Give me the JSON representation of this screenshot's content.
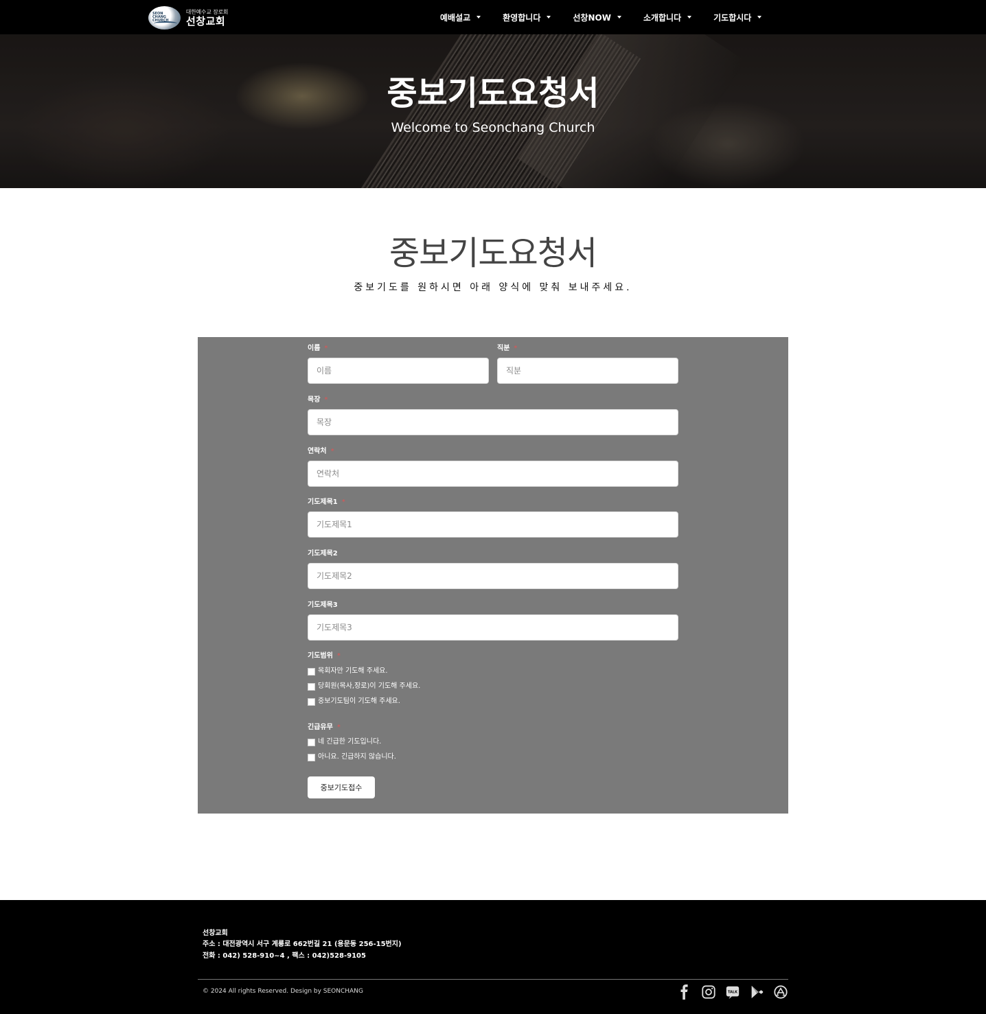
{
  "header": {
    "logo_sub": "대한예수교 장로회",
    "logo_main": "선창교회",
    "logo_badge": "SEON CHANG CHURCH",
    "nav": [
      {
        "label": "예배설교"
      },
      {
        "label": "환영합니다"
      },
      {
        "label": "선창NOW"
      },
      {
        "label": "소개합니다"
      },
      {
        "label": "기도합시다"
      }
    ]
  },
  "hero": {
    "title": "중보기도요청서",
    "subtitle": "Welcome to  Seonchang Church"
  },
  "section": {
    "title": "중보기도요청서",
    "subtitle": "중보기도를 원하시면 아래 양식에 맞춰 보내주세요."
  },
  "form": {
    "required_mark": "*",
    "fields": {
      "name": {
        "label": "이름",
        "placeholder": "이름"
      },
      "position": {
        "label": "직분",
        "placeholder": "직분"
      },
      "mokjang": {
        "label": "목장",
        "placeholder": "목장"
      },
      "contact": {
        "label": "연락처",
        "placeholder": "연락처"
      },
      "title1": {
        "label": "기도제목1",
        "placeholder": "기도제목1"
      },
      "title2": {
        "label": "기도제목2",
        "placeholder": "기도제목2"
      },
      "title3": {
        "label": "기도제목3",
        "placeholder": "기도제목3"
      }
    },
    "scope": {
      "label": "기도범위",
      "options": [
        "목회자만 기도해 주세요.",
        "당회원(목사,장로)이 기도해 주세요.",
        "중보기도팀이 기도해 주세요."
      ]
    },
    "urgency": {
      "label": "긴급유무",
      "options": [
        "네 긴급한 기도입니다.",
        "아니요. 긴급하지 않습니다."
      ]
    },
    "submit_label": "중보기도접수"
  },
  "footer": {
    "name": "선창교회",
    "address": "주소 : 대전광역시 서구 계룡로 662번길 21 (용문동 256-15번지)",
    "phone": "전화 : 042) 528-910~4 , 팩스 : 042)528-9105",
    "copyright": "© 2024 All rights Reserved. Design by SEONCHANG",
    "kakao_label": "TALK",
    "socials": [
      "facebook-icon",
      "instagram-icon",
      "kakaotalk-icon",
      "google-play-icon",
      "app-store-icon"
    ]
  }
}
